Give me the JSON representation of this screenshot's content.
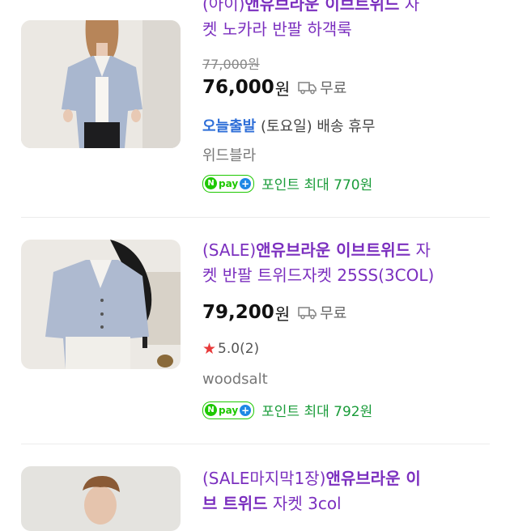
{
  "products": [
    {
      "title_tag": "(아이)",
      "title_highlight": "앤유브라운 이브트위드",
      "title_rest_1": " 자",
      "title_line2": "켓 노카라 반팔 하객룩",
      "original_price": "77,000원",
      "price": "76,000",
      "currency": "원",
      "shipping": "무료",
      "delivery_badge": "오늘출발",
      "delivery_text": " (토요일) 배송 휴무",
      "store": "위드블라",
      "points": "포인트 최대 770원"
    },
    {
      "title_tag": "(SALE)",
      "title_highlight": "앤유브라운 이브트위드",
      "title_rest_1": " 자",
      "title_line2": "켓 반팔 트위드자켓 25SS(3COL)",
      "price": "79,200",
      "currency": "원",
      "shipping": "무료",
      "rating": "5.0",
      "review_count": "(2)",
      "store": "woodsalt",
      "points": "포인트 최대 792원"
    },
    {
      "title_tag": "(SALE마지막1장)",
      "title_highlight": "앤유브라운 이",
      "title_line2_hl": "브 트위드",
      "title_line2_rest": " 자켓 3col"
    }
  ],
  "npay": {
    "n": "N",
    "pay": "pay",
    "plus": "+"
  },
  "colors": {
    "title": "#7b2fbf",
    "points": "#1a9c3a",
    "npay": "#1ec800",
    "star": "#e83a3a",
    "today": "#2f6fd8"
  },
  "icons": [
    "truck-icon",
    "star-icon",
    "npay-icon"
  ]
}
